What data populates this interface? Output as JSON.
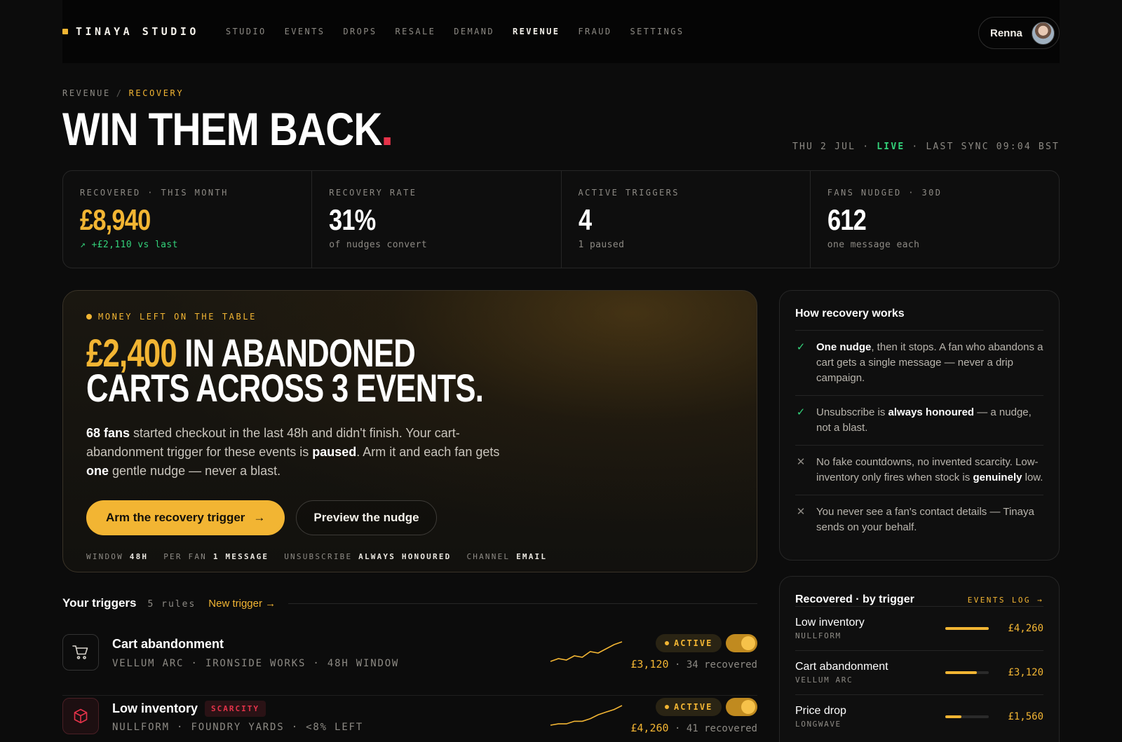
{
  "nav": {
    "brand": "TINAYA STUDIO",
    "links": [
      "STUDIO",
      "EVENTS",
      "DROPS",
      "RESALE",
      "DEMAND",
      "REVENUE",
      "FRAUD",
      "SETTINGS"
    ],
    "active": "REVENUE",
    "user": "Renna"
  },
  "header": {
    "crumb_parent": "REVENUE",
    "crumb_sep": "/",
    "crumb_current": "RECOVERY",
    "title": "WIN THEM BACK",
    "date": "THU 2 JUL",
    "live": "LIVE",
    "sync": "LAST SYNC 09:04 BST",
    "dot_sep": "·"
  },
  "stats": [
    {
      "label": "RECOVERED · THIS MONTH",
      "value": "£8,940",
      "sub": "↗ +£2,110 vs last"
    },
    {
      "label": "RECOVERY RATE",
      "value": "31%",
      "sub": "of nudges convert"
    },
    {
      "label": "ACTIVE TRIGGERS",
      "value": "4",
      "sub": "1 paused"
    },
    {
      "label": "FANS NUDGED · 30D",
      "value": "612",
      "sub": "one message each"
    }
  ],
  "hero": {
    "tag": "MONEY LEFT ON THE TABLE",
    "amount": "£2,400",
    "headline_1": " IN ABANDONED",
    "headline_2": "CARTS ACROSS 3 EVENTS.",
    "body_fans": "68 fans",
    "body_1": " started checkout in the last 48h and didn't finish. Your cart-abandonment trigger for these events is ",
    "body_paused": "paused",
    "body_2": ". Arm it and each fan gets ",
    "body_one": "one",
    "body_3": " gentle nudge — never a blast.",
    "primary_button": "Arm the recovery trigger",
    "primary_arrow": "→",
    "secondary_button": "Preview the nudge",
    "meta": [
      {
        "k": "WINDOW",
        "v": "48H"
      },
      {
        "k": "PER FAN",
        "v": "1 MESSAGE"
      },
      {
        "k": "UNSUBSCRIBE",
        "v": "ALWAYS HONOURED"
      },
      {
        "k": "CHANNEL",
        "v": "EMAIL"
      }
    ]
  },
  "how": {
    "title": "How recovery works",
    "items": [
      {
        "icon": "check",
        "bold": "One nudge",
        "text": ", then it stops. A fan who abandons a cart gets a single message — never a drip campaign."
      },
      {
        "icon": "check",
        "pre": "Unsubscribe is ",
        "bold": "always honoured",
        "text": " — a nudge, not a blast."
      },
      {
        "icon": "cross",
        "pre": "No fake countdowns, no invented scarcity. Low-inventory only fires when stock is ",
        "bold": "genuinely",
        "text": " low."
      },
      {
        "icon": "cross",
        "pre": "You never see a fan's contact details — Tinaya sends on your behalf.",
        "bold": "",
        "text": ""
      }
    ]
  },
  "recovered": {
    "title": "Recovered · by trigger",
    "link": "EVENTS LOG →",
    "rows": [
      {
        "name": "Low inventory",
        "sub": "NULLFORM",
        "amount": "£4,260",
        "fraction": 1.0
      },
      {
        "name": "Cart abandonment",
        "sub": "VELLUM ARC",
        "amount": "£3,120",
        "fraction": 0.73
      },
      {
        "name": "Price drop",
        "sub": "LONGWAVE",
        "amount": "£1,560",
        "fraction": 0.37
      }
    ]
  },
  "triggers": {
    "title": "Your triggers",
    "count": "5 rules",
    "new_link": "New trigger →",
    "rows": [
      {
        "name": "Cart abandonment",
        "tag": "",
        "sub": "VELLUM ARC · IRONSIDE WORKS · 48H WINDOW",
        "status": "ACTIVE",
        "amount": "£3,120",
        "recovered": "· 34 recovered",
        "spark": [
          8,
          10,
          9,
          12,
          11,
          15,
          14,
          17,
          20,
          22
        ]
      },
      {
        "name": "Low inventory",
        "tag": "SCARCITY",
        "sub": "NULLFORM · FOUNDRY YARDS · <8% LEFT",
        "status": "ACTIVE",
        "amount": "£4,260",
        "recovered": "· 41 recovered",
        "spark": [
          6,
          7,
          7,
          9,
          9,
          11,
          14,
          16,
          18,
          21
        ]
      }
    ]
  },
  "colors": {
    "accent": "#f2b533",
    "live": "#33d17a",
    "danger": "#e5334a",
    "bg": "#0c0c0c"
  }
}
